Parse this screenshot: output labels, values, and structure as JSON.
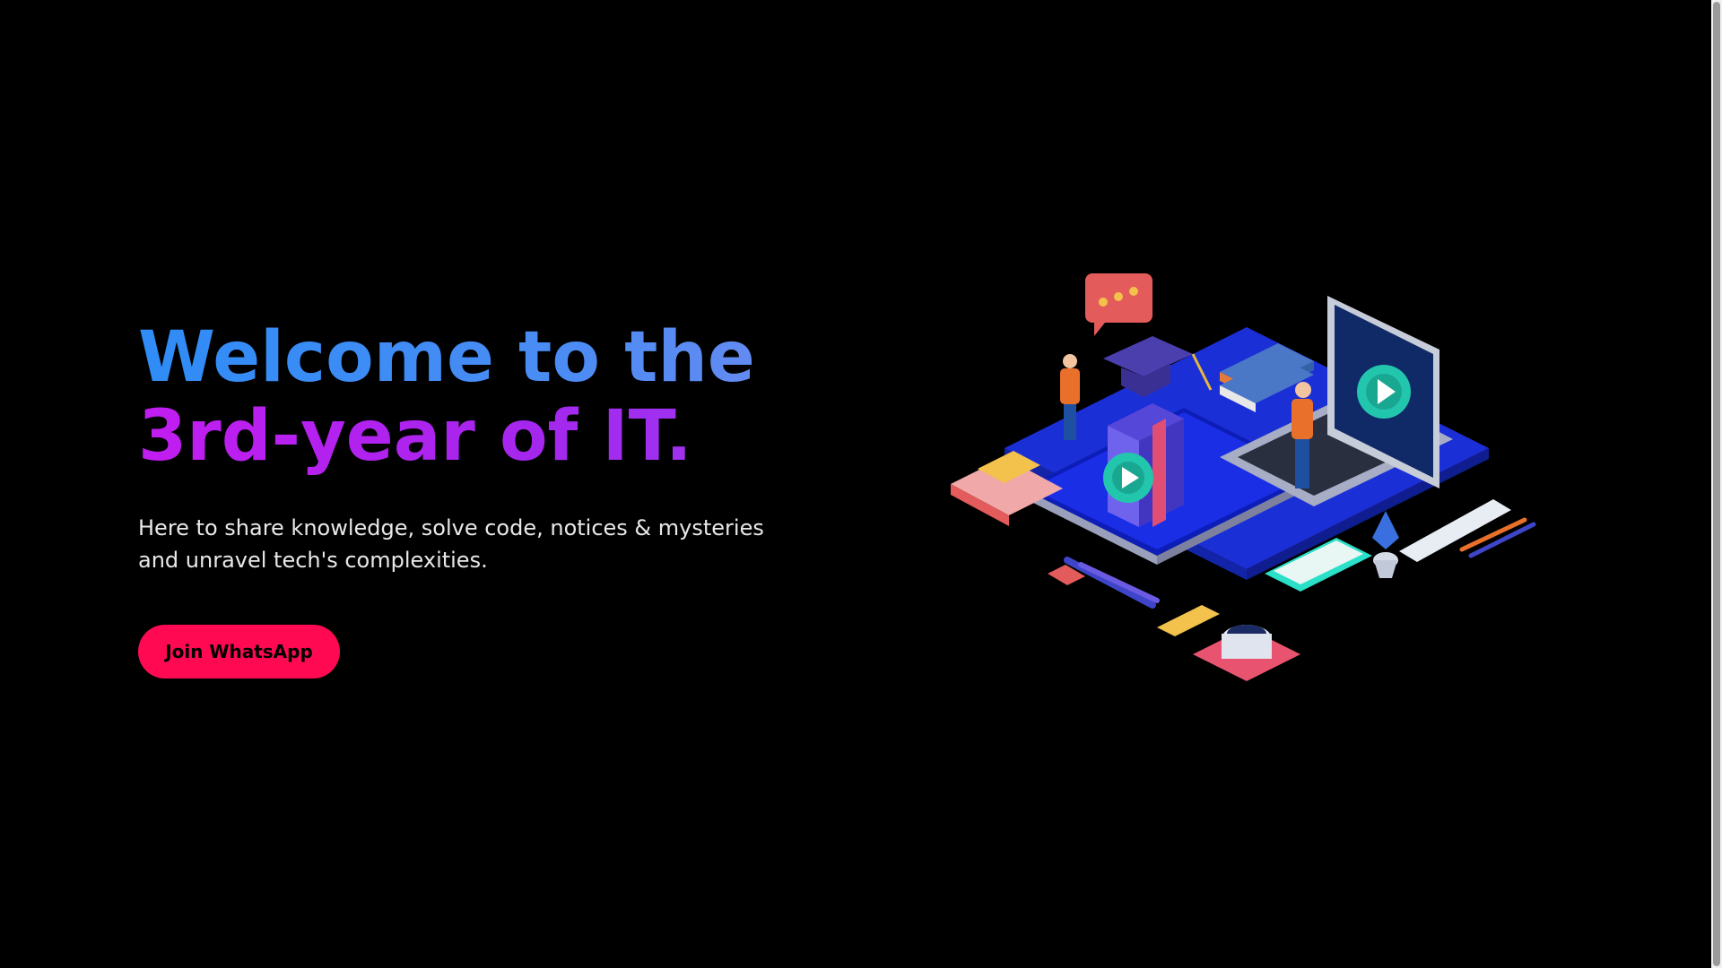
{
  "hero": {
    "title_line1": "Welcome to the",
    "title_line2": "3rd-year of IT.",
    "subtitle": "Here to share knowledge, solve code, notices & mysteries and unravel tech's complexities.",
    "cta_label": "Join WhatsApp"
  },
  "illustration": {
    "icon": "isometric-education-illustration"
  },
  "colors": {
    "background": "#000000",
    "title_blue": "#2f8cf6",
    "title_purple": "#c21df0",
    "cta": "#ff0a52"
  }
}
